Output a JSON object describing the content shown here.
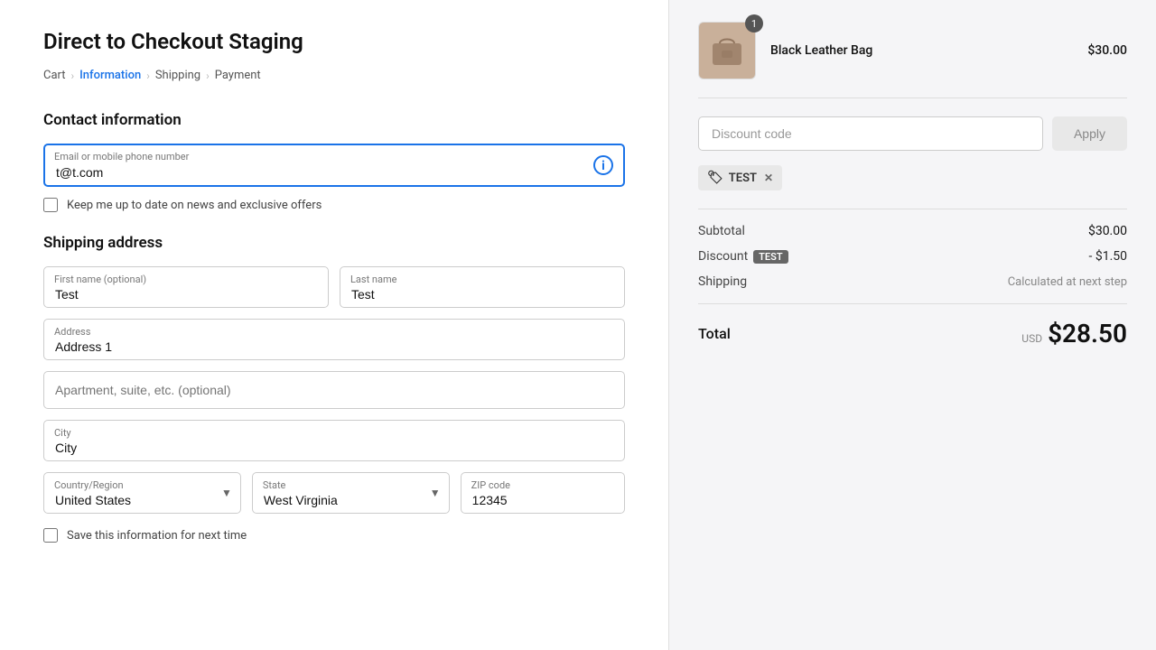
{
  "page": {
    "title": "Direct to Checkout Staging"
  },
  "breadcrumb": {
    "items": [
      {
        "label": "Cart",
        "active": false
      },
      {
        "label": "Information",
        "active": true
      },
      {
        "label": "Shipping",
        "active": false
      },
      {
        "label": "Payment",
        "active": false
      }
    ]
  },
  "contact": {
    "section_title": "Contact information",
    "email_label": "Email or mobile phone number",
    "email_value": "t@t.com",
    "checkbox_label": "Keep me up to date on news and exclusive offers"
  },
  "shipping": {
    "section_title": "Shipping address",
    "first_name_label": "First name (optional)",
    "first_name_value": "Test",
    "last_name_label": "Last name",
    "last_name_value": "Test",
    "address_label": "Address",
    "address_value": "Address 1",
    "address2_placeholder": "Apartment, suite, etc. (optional)",
    "city_label": "City",
    "city_value": "City",
    "country_label": "Country/Region",
    "country_value": "United States",
    "state_label": "State",
    "state_value": "West Virginia",
    "zip_label": "ZIP code",
    "zip_value": "12345",
    "save_checkbox_label": "Save this information for next time"
  },
  "order_summary": {
    "product_name": "Black Leather Bag",
    "product_price": "$30.00",
    "product_badge": "1",
    "discount_placeholder": "Discount code",
    "apply_label": "Apply",
    "discount_tag": "TEST",
    "subtotal_label": "Subtotal",
    "subtotal_value": "$30.00",
    "discount_label": "Discount",
    "discount_code_badge": "TEST",
    "discount_value": "- $1.50",
    "shipping_label": "Shipping",
    "shipping_value": "Calculated at next step",
    "total_label": "Total",
    "total_currency": "USD",
    "total_value": "$28.50"
  }
}
